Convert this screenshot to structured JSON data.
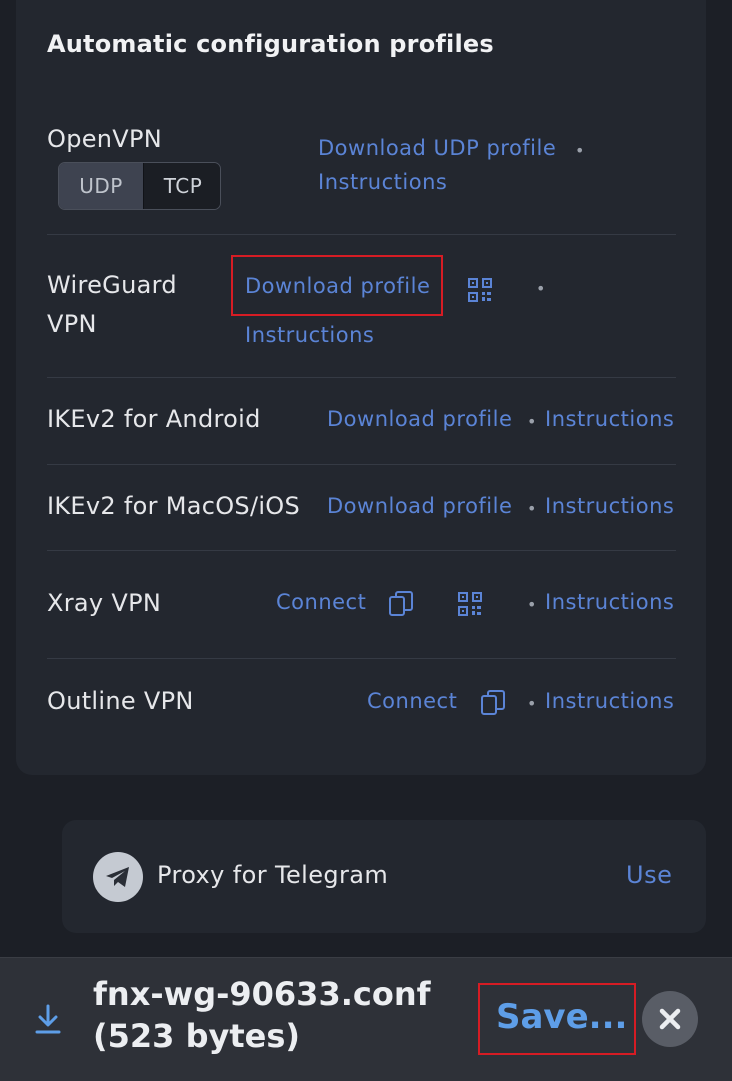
{
  "section_title": "Automatic configuration profiles",
  "rows": {
    "openvpn": {
      "label": "OpenVPN",
      "udp": "UDP",
      "tcp": "TCP",
      "download": "Download UDP profile",
      "instructions": "Instructions"
    },
    "wireguard": {
      "label_line1": "WireGuard",
      "label_line2": "VPN",
      "download": "Download profile",
      "instructions": "Instructions"
    },
    "ikev2_android": {
      "label": "IKEv2 for Android",
      "download": "Download profile",
      "instructions": "Instructions"
    },
    "ikev2_macos": {
      "label": "IKEv2 for MacOS/iOS",
      "download": "Download profile",
      "instructions": "Instructions"
    },
    "xray": {
      "label": "Xray VPN",
      "connect": "Connect",
      "instructions": "Instructions"
    },
    "outline": {
      "label": "Outline VPN",
      "connect": "Connect",
      "instructions": "Instructions"
    }
  },
  "separator": "•",
  "proxy": {
    "label": "Proxy for Telegram",
    "use": "Use"
  },
  "download_bar": {
    "filename": "fnx-wg-90633.conf",
    "size": "(523 bytes)",
    "save": "Save..."
  },
  "icons": {
    "qr": "qr-code-icon",
    "copy": "copy-icon",
    "telegram": "telegram-icon",
    "download": "download-arrow-icon",
    "close": "close-icon"
  },
  "colors": {
    "background": "#1c1f26",
    "card": "#23272f",
    "link": "#5b84d6",
    "save": "#5e9ee8",
    "highlight": "#d61c24"
  }
}
